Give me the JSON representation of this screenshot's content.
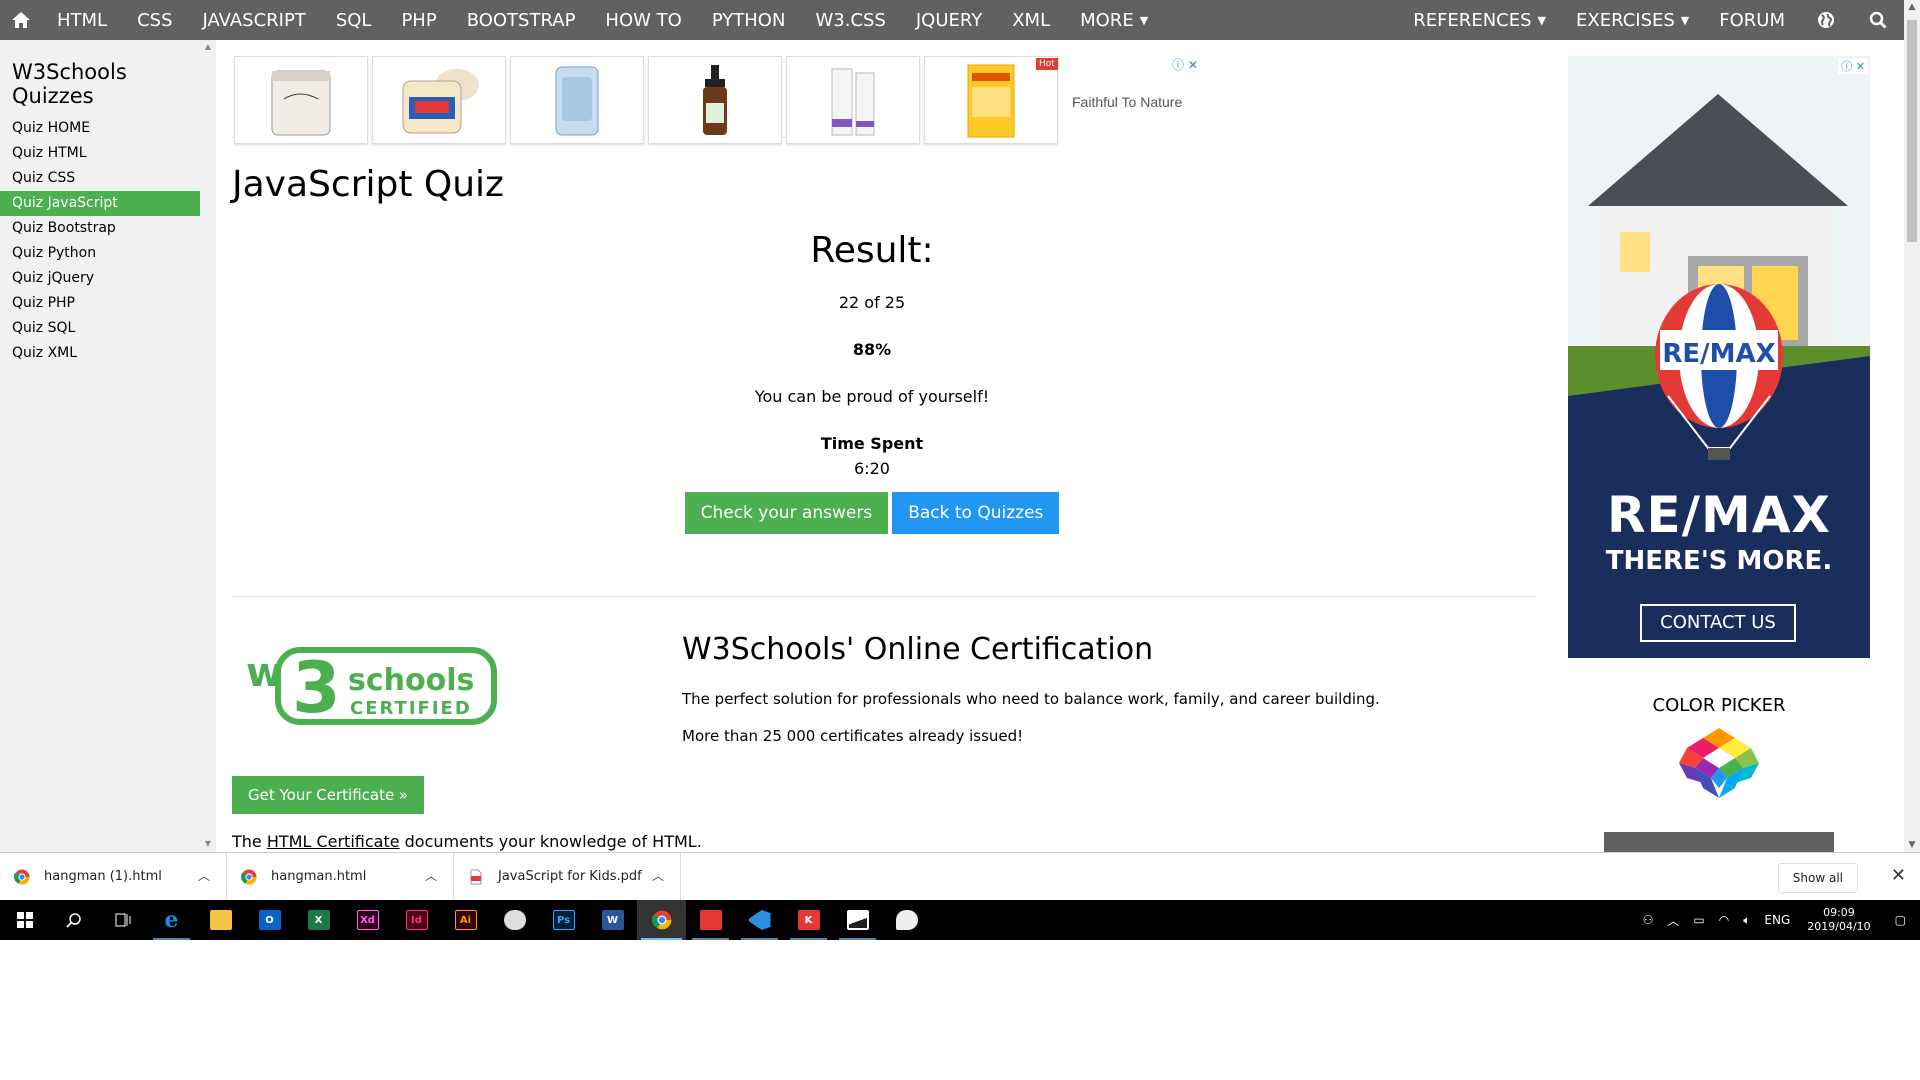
{
  "topnav": {
    "items": [
      "HTML",
      "CSS",
      "JAVASCRIPT",
      "SQL",
      "PHP",
      "BOOTSTRAP",
      "HOW TO",
      "PYTHON",
      "W3.CSS",
      "JQUERY",
      "XML",
      "MORE"
    ],
    "right_items": [
      "REFERENCES",
      "EXERCISES",
      "FORUM"
    ],
    "background": "#616161"
  },
  "sidebar": {
    "title": "W3Schools Quizzes",
    "items": [
      "Quiz HOME",
      "Quiz HTML",
      "Quiz CSS",
      "Quiz JavaScript",
      "Quiz Bootstrap",
      "Quiz Python",
      "Quiz jQuery",
      "Quiz PHP",
      "Quiz SQL",
      "Quiz XML"
    ],
    "active_index": 3,
    "active_color": "#4caf50"
  },
  "ad_strip": {
    "hot_badge": "Hot",
    "tagline": "Faithful To Nature"
  },
  "main": {
    "page_title": "JavaScript Quiz",
    "result_title": "Result:",
    "score": "22 of 25",
    "percent": "88%",
    "message": "You can be proud of yourself!",
    "time_label": "Time Spent",
    "time_value": "6:20",
    "check_button": "Check your answers",
    "back_button": "Back to Quizzes"
  },
  "certification": {
    "title": "W3Schools' Online Certification",
    "text1": "The perfect solution for professionals who need to balance work, family, and career building.",
    "text2": "More than 25 000 certificates already issued!",
    "button": "Get Your Certificate »",
    "logo_text1": "schools",
    "logo_text2": "CERTIFIED",
    "footer_prefix": "The ",
    "footer_link": "HTML Certificate",
    "footer_suffix": " documents your knowledge of HTML."
  },
  "right_ad": {
    "balloon_text": "RE/MAX",
    "brand": "RE/MAX",
    "slogan": "THERE'S MORE.",
    "cta": "CONTACT US"
  },
  "color_picker": {
    "title": "COLOR PICKER"
  },
  "downloads": {
    "items": [
      "hangman (1).html",
      "hangman.html",
      "JavaScript for Kids.pdf"
    ],
    "show_all": "Show all"
  },
  "taskbar": {
    "apps": [
      {
        "name": "edge",
        "label": "e",
        "color": "#1e88e5"
      },
      {
        "name": "explorer",
        "label": "",
        "color": "#f4c542"
      },
      {
        "name": "outlook",
        "label": "O",
        "color": "#0a64c8"
      },
      {
        "name": "excel",
        "label": "X",
        "color": "#1d7a45"
      },
      {
        "name": "xd",
        "label": "Xd",
        "color": "#ff2bc2"
      },
      {
        "name": "indesign",
        "label": "Id",
        "color": "#ff3366"
      },
      {
        "name": "illustrator",
        "label": "Ai",
        "color": "#ff7c00"
      },
      {
        "name": "app",
        "label": "",
        "color": "#ffffff"
      },
      {
        "name": "photoshop",
        "label": "Ps",
        "color": "#31a8ff"
      },
      {
        "name": "word",
        "label": "W",
        "color": "#2b579a"
      },
      {
        "name": "chrome",
        "label": "",
        "color": "#ffffff"
      },
      {
        "name": "acrobat",
        "label": "",
        "color": "#e53935"
      },
      {
        "name": "vscode",
        "label": "",
        "color": "#2b8de0"
      },
      {
        "name": "kaspersky",
        "label": "K",
        "color": "#e53935"
      },
      {
        "name": "photos",
        "label": "",
        "color": "#ffffff"
      },
      {
        "name": "paint",
        "label": "",
        "color": "#ffffff"
      }
    ],
    "lang": "ENG",
    "time": "09:09",
    "date": "2019/04/10"
  }
}
